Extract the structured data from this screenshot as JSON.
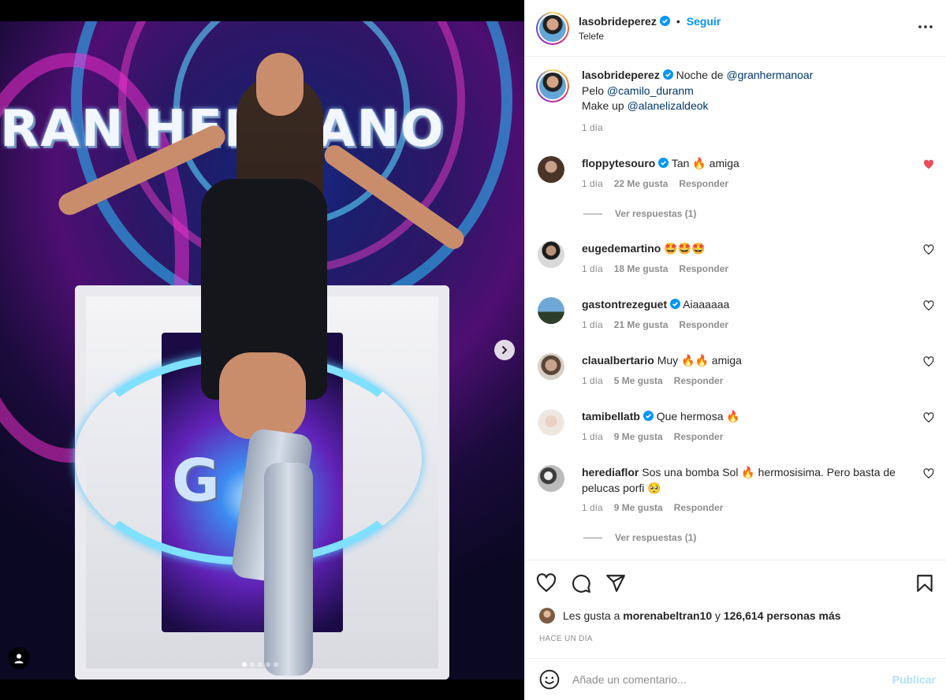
{
  "post": {
    "username": "lasobrideperez",
    "follow_label": "Seguir",
    "separator": "•",
    "location": "Telefe",
    "caption_line1_prefix": "Noche de ",
    "caption_mention1": "@granhermanoar",
    "caption_line2_prefix": "Pelo ",
    "caption_mention2": "@camilo_duranm",
    "caption_line3_prefix": "Make up ",
    "caption_mention3": "@alanelizaldeok",
    "caption_time": "1 día",
    "media_sign_text": "RAN HERMANO",
    "media_podium_letter": "G",
    "carousel_total": 5,
    "carousel_active": 1
  },
  "comments": [
    {
      "user": "floppytesouro",
      "verified": true,
      "text": "Tan 🔥 amiga",
      "time": "1 día",
      "likes": "22 Me gusta",
      "reply": "Responder",
      "liked": true,
      "view_replies": "Ver respuestas (1)"
    },
    {
      "user": "eugedemartino",
      "verified": false,
      "text": "🤩🤩🤩",
      "time": "1 día",
      "likes": "18 Me gusta",
      "reply": "Responder",
      "liked": false
    },
    {
      "user": "gastontrezeguet",
      "verified": true,
      "text": "Aiaaaaaa",
      "time": "1 día",
      "likes": "21 Me gusta",
      "reply": "Responder",
      "liked": false
    },
    {
      "user": "claualbertario",
      "verified": false,
      "text": "Muy 🔥🔥 amiga",
      "time": "1 día",
      "likes": "5 Me gusta",
      "reply": "Responder",
      "liked": false
    },
    {
      "user": "tamibellatb",
      "verified": true,
      "text": "Que hermosa 🔥",
      "time": "1 día",
      "likes": "9 Me gusta",
      "reply": "Responder",
      "liked": false
    },
    {
      "user": "herediaflor",
      "verified": false,
      "text": "Sos una bomba Sol 🔥 hermosisima. Pero basta de pelucas porfi 🥺",
      "time": "1 día",
      "likes": "9 Me gusta",
      "reply": "Responder",
      "liked": false,
      "view_replies": "Ver respuestas (1)"
    }
  ],
  "actions": {
    "likes_prefix": "Les gusta a ",
    "likes_user": "morenabeltran10",
    "likes_mid": " y ",
    "likes_count": "126,614 personas más",
    "timestamp": "HACE UN DÍA"
  },
  "add_comment": {
    "placeholder": "Añade un comentario...",
    "publish_label": "Publicar"
  },
  "icons": {
    "verified": "verified-badge-icon",
    "more": "more-options-icon",
    "next": "chevron-right-icon",
    "tag": "user-tag-icon",
    "like": "heart-icon",
    "comment": "comment-bubble-icon",
    "share": "paper-plane-icon",
    "save": "bookmark-icon",
    "emoji": "smiley-icon"
  },
  "colors": {
    "accent": "#0095f6",
    "liked_heart": "#ed4956",
    "link": "#00376b",
    "muted": "#8e8e8e",
    "publish_disabled": "#b2dffc"
  }
}
